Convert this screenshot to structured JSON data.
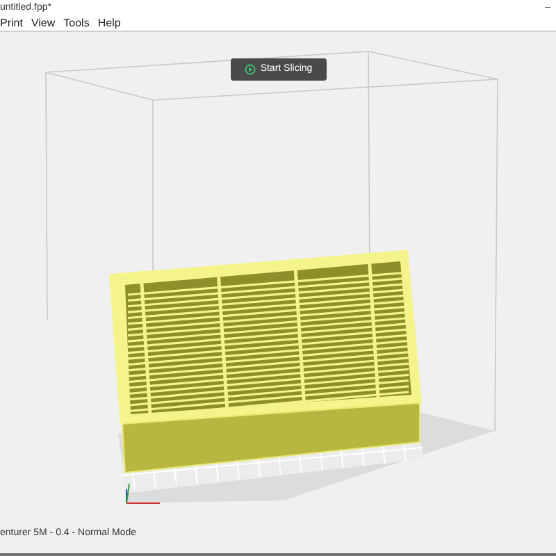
{
  "window": {
    "title": "untitled.fpp*",
    "minimize": "–"
  },
  "menu": [
    "Print",
    "View",
    "Tools",
    "Help"
  ],
  "slice_button": {
    "label": "Start Slicing"
  },
  "status_bar": {
    "text": "enturer 5M - 0.4 - Normal Mode"
  }
}
